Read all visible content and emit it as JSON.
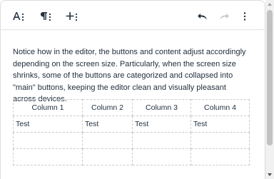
{
  "toolbar": {
    "buttons": [
      {
        "name": "text-format-icon",
        "glyph": "A"
      },
      {
        "name": "paragraph-icon",
        "glyph": "¶"
      },
      {
        "name": "insert-icon",
        "glyph": "+"
      }
    ]
  },
  "content": {
    "paragraph": "Notice how in the editor, the buttons and content adjust accordingly depending on the screen size. Particularly, when the screen size shrinks, some of the buttons are categorized and collapsed into \"main\" buttons, keeping the editor clean and visually pleasant across devices."
  },
  "table": {
    "headers": [
      "Column 1",
      "Column 2",
      "Column 3",
      "Column 4"
    ],
    "rows": [
      [
        "Test",
        "Test",
        "Test",
        "Test"
      ],
      [
        "",
        "",
        "",
        ""
      ],
      [
        "",
        "",
        "",
        ""
      ]
    ]
  },
  "colors": {
    "text": "#222f3e",
    "border": "#dcdcdc",
    "disabled": "#c8c8c8"
  }
}
